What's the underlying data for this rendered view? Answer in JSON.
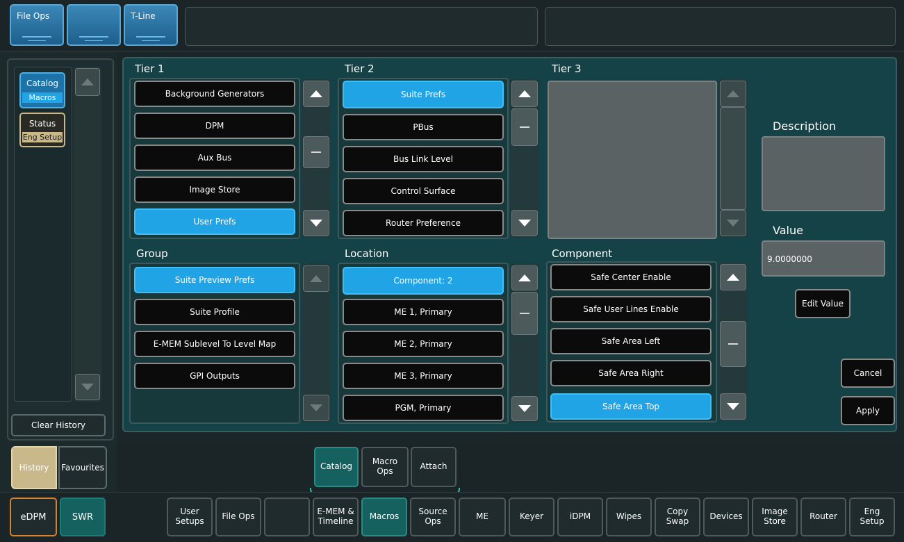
{
  "top_bar": {
    "buttons": [
      {
        "label": "File Ops"
      },
      {
        "label": ""
      },
      {
        "label": "T-Line"
      }
    ]
  },
  "sidebar": {
    "catalog": {
      "label": "Catalog",
      "sub": "Macros"
    },
    "status": {
      "label": "Status",
      "sub": "Eng Setup"
    },
    "clear_history": "Clear History",
    "history": "History",
    "favourites": "Favourites",
    "edpm": "eDPM",
    "swr": "SWR"
  },
  "tier1": {
    "title": "Tier 1",
    "items": [
      "Background Generators",
      "DPM",
      "Aux Bus",
      "Image Store",
      "User Prefs"
    ],
    "selected_index": 4
  },
  "tier2": {
    "title": "Tier 2",
    "items": [
      "Suite Prefs",
      "PBus",
      "Bus Link Level",
      "Control Surface",
      "Router Preference"
    ],
    "selected_index": 0
  },
  "tier3": {
    "title": "Tier 3",
    "items": []
  },
  "group": {
    "title": "Group",
    "items": [
      "Suite Preview Prefs",
      "Suite Profile",
      "E-MEM Sublevel To Level Map",
      "GPI Outputs"
    ],
    "selected_index": 0
  },
  "location": {
    "title": "Location",
    "items": [
      "Component: 2",
      "ME 1, Primary",
      "ME 2, Primary",
      "ME 3, Primary",
      "PGM, Primary"
    ],
    "selected_index": 0
  },
  "component": {
    "title": "Component",
    "items": [
      "Safe Center Enable",
      "Safe User Lines Enable",
      "Safe Area Left",
      "Safe Area Right",
      "Safe Area Top"
    ],
    "selected_index": 4
  },
  "right_panel": {
    "description_label": "Description",
    "description_value": "",
    "value_label": "Value",
    "value": "9.0000000",
    "edit_value": "Edit Value",
    "cancel": "Cancel",
    "apply": "Apply"
  },
  "sub_tabs": {
    "catalog": "Catalog",
    "macro_ops_1": "Macro",
    "macro_ops_2": "Ops",
    "attach": "Attach"
  },
  "bottom_nav": [
    {
      "l1": "User",
      "l2": "Setups"
    },
    {
      "l1": "File Ops",
      "l2": ""
    },
    {
      "l1": "",
      "l2": ""
    },
    {
      "l1": "E-MEM &",
      "l2": "Timeline"
    },
    {
      "l1": "Macros",
      "l2": ""
    },
    {
      "l1": "Source",
      "l2": "Ops"
    },
    {
      "l1": "ME",
      "l2": ""
    },
    {
      "l1": "Keyer",
      "l2": ""
    },
    {
      "l1": "iDPM",
      "l2": ""
    },
    {
      "l1": "Wipes",
      "l2": ""
    },
    {
      "l1": "Copy",
      "l2": "Swap"
    },
    {
      "l1": "Devices",
      "l2": ""
    },
    {
      "l1": "Image",
      "l2": "Store"
    },
    {
      "l1": "Router",
      "l2": ""
    },
    {
      "l1": "Eng",
      "l2": "Setup"
    }
  ],
  "colors": {
    "accent_blue": "#20a4e6",
    "teal_active": "#14615f",
    "tan_active": "#c9b98a",
    "orange_border": "#d9822b"
  }
}
